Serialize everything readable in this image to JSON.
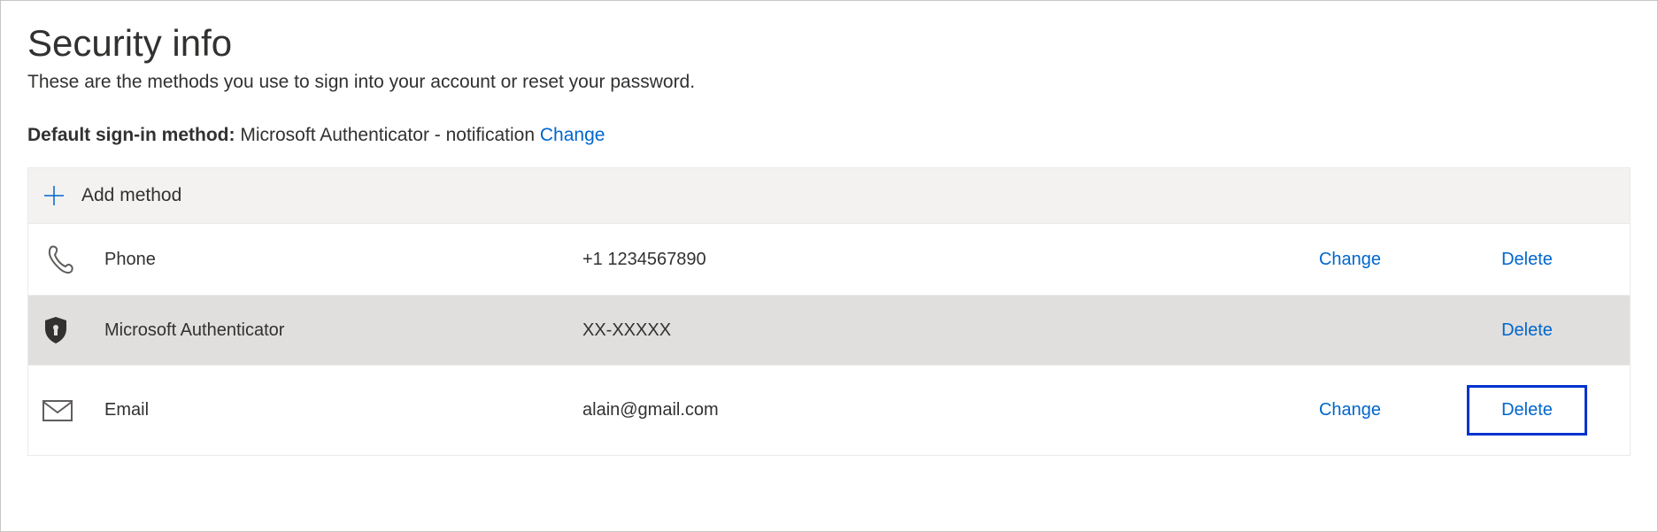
{
  "header": {
    "title": "Security info",
    "subtitle": "These are the methods you use to sign into your account or reset your password."
  },
  "default_method": {
    "label": "Default sign-in method:",
    "value": "Microsoft Authenticator - notification",
    "change_label": "Change"
  },
  "add_method": {
    "label": "Add method"
  },
  "methods": [
    {
      "icon": "phone-icon",
      "name": "Phone",
      "value": "+1 1234567890",
      "change_label": "Change",
      "delete_label": "Delete"
    },
    {
      "icon": "authenticator-icon",
      "name": "Microsoft Authenticator",
      "value": "XX-XXXXX",
      "change_label": "",
      "delete_label": "Delete"
    },
    {
      "icon": "email-icon",
      "name": "Email",
      "value": "alain@gmail.com",
      "change_label": "Change",
      "delete_label": "Delete"
    }
  ],
  "colors": {
    "link": "#0066cc",
    "highlight_border": "#0033cc",
    "row_highlight": "#e1dfdd"
  }
}
